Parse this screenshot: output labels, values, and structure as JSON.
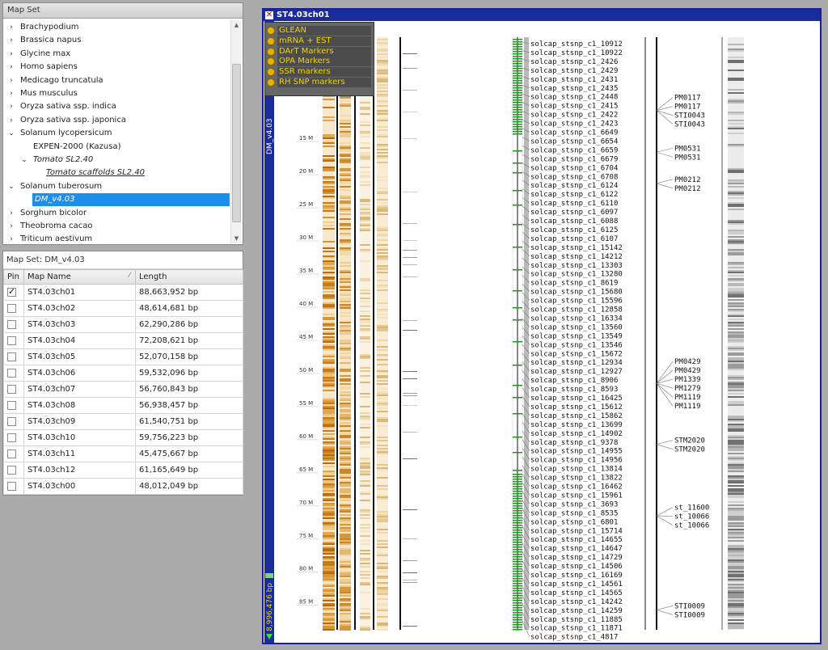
{
  "tree": {
    "header": "Map Set",
    "items": [
      {
        "label": "Brachypodium",
        "level": 0,
        "chevron": "›",
        "style": ""
      },
      {
        "label": "Brassica napus",
        "level": 0,
        "chevron": "›",
        "style": ""
      },
      {
        "label": "Glycine max",
        "level": 0,
        "chevron": "›",
        "style": ""
      },
      {
        "label": "Homo sapiens",
        "level": 0,
        "chevron": "›",
        "style": ""
      },
      {
        "label": "Medicago truncatula",
        "level": 0,
        "chevron": "›",
        "style": ""
      },
      {
        "label": "Mus musculus",
        "level": 0,
        "chevron": "›",
        "style": ""
      },
      {
        "label": "Oryza sativa ssp. indica",
        "level": 0,
        "chevron": "›",
        "style": ""
      },
      {
        "label": "Oryza sativa ssp. japonica",
        "level": 0,
        "chevron": "›",
        "style": ""
      },
      {
        "label": "Solanum lycopersicum",
        "level": 0,
        "chevron": "⌄",
        "style": ""
      },
      {
        "label": "EXPEN-2000 (Kazusa)",
        "level": 1,
        "chevron": "",
        "style": ""
      },
      {
        "label": "Tomato SL2.40",
        "level": 1,
        "chevron": "⌄",
        "style": "it"
      },
      {
        "label": "Tomato scaffolds SL2.40",
        "level": 2,
        "chevron": "",
        "style": "ul"
      },
      {
        "label": "Solanum tuberosum",
        "level": 0,
        "chevron": "⌄",
        "style": ""
      },
      {
        "label": "DM_v4.03",
        "level": 1,
        "chevron": "",
        "style": "sel"
      },
      {
        "label": "Sorghum bicolor",
        "level": 0,
        "chevron": "›",
        "style": ""
      },
      {
        "label": "Theobroma cacao",
        "level": 0,
        "chevron": "›",
        "style": ""
      },
      {
        "label": "Triticum aestivum",
        "level": 0,
        "chevron": "›",
        "style": ""
      }
    ]
  },
  "map_table": {
    "title": "Map Set: DM_v4.03",
    "columns": [
      "Pin",
      "Map Name",
      "Length"
    ],
    "sort_indicator": "⁄",
    "rows": [
      {
        "pinned": true,
        "name": "ST4.03ch01",
        "length": "88,663,952 bp"
      },
      {
        "pinned": false,
        "name": "ST4.03ch02",
        "length": "48,614,681 bp"
      },
      {
        "pinned": false,
        "name": "ST4.03ch03",
        "length": "62,290,286 bp"
      },
      {
        "pinned": false,
        "name": "ST4.03ch04",
        "length": "72,208,621 bp"
      },
      {
        "pinned": false,
        "name": "ST4.03ch05",
        "length": "52,070,158 bp"
      },
      {
        "pinned": false,
        "name": "ST4.03ch06",
        "length": "59,532,096 bp"
      },
      {
        "pinned": false,
        "name": "ST4.03ch07",
        "length": "56,760,843 bp"
      },
      {
        "pinned": false,
        "name": "ST4.03ch08",
        "length": "56,938,457 bp"
      },
      {
        "pinned": false,
        "name": "ST4.03ch09",
        "length": "61,540,751 bp"
      },
      {
        "pinned": false,
        "name": "ST4.03ch10",
        "length": "59,756,223 bp"
      },
      {
        "pinned": false,
        "name": "ST4.03ch11",
        "length": "45,475,667 bp"
      },
      {
        "pinned": false,
        "name": "ST4.03ch12",
        "length": "61,165,649 bp"
      },
      {
        "pinned": false,
        "name": "ST4.03ch00",
        "length": "48,012,049 bp"
      }
    ]
  },
  "map_window": {
    "title": "ST4.03ch01",
    "close_glyph": "✕",
    "vertical_label": "DM_v4.03",
    "start_label": "8,996,476 bp",
    "legend": [
      "GLEAN",
      "mRNA + EST",
      "DArT Markers",
      "OPA Markers",
      "SSR markers",
      "RH SNP markers"
    ],
    "ruler_ticks": [
      {
        "value": 15,
        "label": "15 M"
      },
      {
        "value": 20,
        "label": "20 M"
      },
      {
        "value": 25,
        "label": "25 M"
      },
      {
        "value": 30,
        "label": "30 M"
      },
      {
        "value": 35,
        "label": "35 M"
      },
      {
        "value": 40,
        "label": "40 M"
      },
      {
        "value": 45,
        "label": "45 M"
      },
      {
        "value": 50,
        "label": "50 M"
      },
      {
        "value": 55,
        "label": "55 M"
      },
      {
        "value": 60,
        "label": "60 M"
      },
      {
        "value": 65,
        "label": "65 M"
      },
      {
        "value": 70,
        "label": "70 M"
      },
      {
        "value": 75,
        "label": "75 M"
      },
      {
        "value": 80,
        "label": "80 M"
      },
      {
        "value": 85,
        "label": "85 M"
      }
    ],
    "snp_markers": [
      "solcap_stsnp_c1_10912",
      "solcap_stsnp_c1_10922",
      "solcap_stsnp_c1_2426",
      "solcap_stsnp_c1_2429",
      "solcap_stsnp_c1_2431",
      "solcap_stsnp_c1_2435",
      "solcap_stsnp_c1_2448",
      "solcap_stsnp_c1_2415",
      "solcap_stsnp_c1_2422",
      "solcap_stsnp_c1_2423",
      "solcap_stsnp_c1_6649",
      "solcap_stsnp_c1_6654",
      "solcap_stsnp_c1_6659",
      "solcap_stsnp_c1_6679",
      "solcap_stsnp_c1_6704",
      "solcap_stsnp_c1_6708",
      "solcap_stsnp_c1_6124",
      "solcap_stsnp_c1_6122",
      "solcap_stsnp_c1_6110",
      "solcap_stsnp_c1_6097",
      "solcap_stsnp_c1_6088",
      "solcap_stsnp_c1_6125",
      "solcap_stsnp_c1_6107",
      "solcap_stsnp_c1_15142",
      "solcap_stsnp_c1_14212",
      "solcap_stsnp_c1_13303",
      "solcap_stsnp_c1_13280",
      "solcap_stsnp_c1_8619",
      "solcap_stsnp_c1_15680",
      "solcap_stsnp_c1_15596",
      "solcap_stsnp_c1_12858",
      "solcap_stsnp_c1_16334",
      "solcap_stsnp_c1_13560",
      "solcap_stsnp_c1_13549",
      "solcap_stsnp_c1_13546",
      "solcap_stsnp_c1_15672",
      "solcap_stsnp_c1_12934",
      "solcap_stsnp_c1_12927",
      "solcap_stsnp_c1_8906",
      "solcap_stsnp_c1_8593",
      "solcap_stsnp_c1_16425",
      "solcap_stsnp_c1_15612",
      "solcap_stsnp_c1_15862",
      "solcap_stsnp_c1_13699",
      "solcap_stsnp_c1_14902",
      "solcap_stsnp_c1_9378",
      "solcap_stsnp_c1_14955",
      "solcap_stsnp_c1_14956",
      "solcap_stsnp_c1_13814",
      "solcap_stsnp_c1_13822",
      "solcap_stsnp_c1_16462",
      "solcap_stsnp_c1_15961",
      "solcap_stsnp_c1_3693",
      "solcap_stsnp_c1_8535",
      "solcap_stsnp_c1_6801",
      "solcap_stsnp_c1_15714",
      "solcap_stsnp_c1_14655",
      "solcap_stsnp_c1_14647",
      "solcap_stsnp_c1_14729",
      "solcap_stsnp_c1_14506",
      "solcap_stsnp_c1_16169",
      "solcap_stsnp_c1_14561",
      "solcap_stsnp_c1_14565",
      "solcap_stsnp_c1_14242",
      "solcap_stsnp_c1_14259",
      "solcap_stsnp_c1_11885",
      "solcap_stsnp_c1_11871",
      "solcap_stsnp_c1_4817"
    ],
    "ssr_marker_groups": [
      {
        "labels": [
          "PM0117",
          "PM0117",
          "STI0043",
          "STI0043"
        ],
        "pos": 10.3
      },
      {
        "labels": [
          "PM0531",
          "PM0531"
        ],
        "pos": 16.6
      },
      {
        "labels": [
          "PM0212",
          "PM0212"
        ],
        "pos": 21.3
      },
      {
        "labels": [
          "PM0429",
          "PM0429",
          "PM1339",
          "PM1279",
          "PM1119",
          "PM1119"
        ],
        "pos": 51.5
      },
      {
        "labels": [
          "STM2020",
          "STM2020"
        ],
        "pos": 60.7
      },
      {
        "labels": [
          "st_11600",
          "st_10066",
          "st_10066"
        ],
        "pos": 71.5
      },
      {
        "labels": [
          "STI0009",
          "STI0009"
        ],
        "pos": 85.7
      }
    ],
    "colors": {
      "titlebar": "#1b2b9c",
      "selection": "#1e8fe8",
      "legend_text": "#f0d400",
      "snp_green": "#1a9a1a"
    }
  }
}
